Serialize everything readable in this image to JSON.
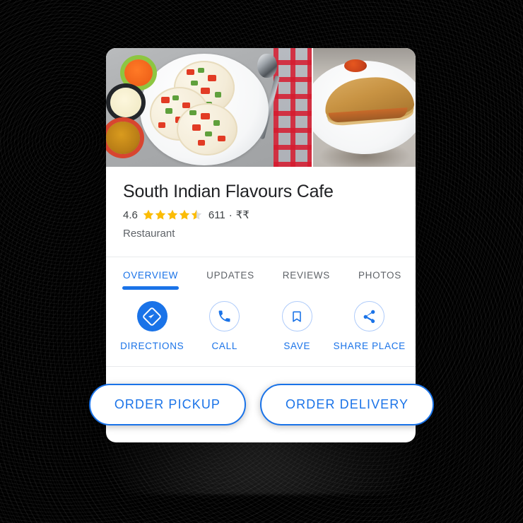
{
  "theme": {
    "accent_blue": "#1a73e8",
    "accent_blue_light": "#aecbfa",
    "star_gold": "#fbbc04",
    "text_primary": "#202124",
    "text_secondary": "#5f6368",
    "card_background": "#ffffff",
    "page_background": "#000000"
  },
  "place": {
    "name": "South Indian Flavours Cafe",
    "rating": "4.6",
    "stars_filled": 4,
    "stars_half": 1,
    "review_count": "611",
    "separator": "·",
    "price_level": "₹₹",
    "category": "Restaurant"
  },
  "photos": [
    {
      "name": "uttapam-plate-photo",
      "alt": "Uttapam with chutneys on a white plate"
    },
    {
      "name": "dosa-plate-photo",
      "alt": "Dosa on a white plate"
    }
  ],
  "tabs": [
    {
      "label": "OVERVIEW",
      "active": true
    },
    {
      "label": "UPDATES",
      "active": false
    },
    {
      "label": "REVIEWS",
      "active": false
    },
    {
      "label": "PHOTOS",
      "active": false
    }
  ],
  "actions": [
    {
      "label": "DIRECTIONS",
      "icon": "directions-icon",
      "style": "filled"
    },
    {
      "label": "CALL",
      "icon": "phone-icon",
      "style": "outlined"
    },
    {
      "label": "SAVE",
      "icon": "bookmark-icon",
      "style": "outlined"
    },
    {
      "label": "SHARE PLACE",
      "icon": "share-icon",
      "style": "outlined"
    }
  ],
  "order_buttons": [
    {
      "label": "ORDER PICKUP"
    },
    {
      "label": "ORDER DELIVERY"
    }
  ]
}
